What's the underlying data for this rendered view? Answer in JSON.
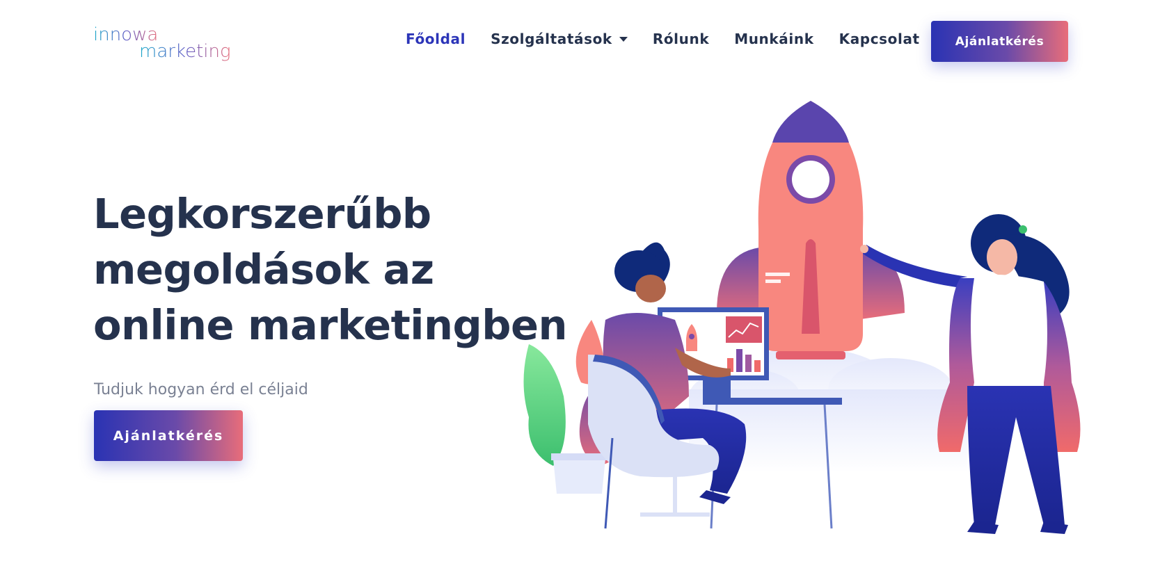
{
  "logo": {
    "line1": "innowa",
    "line2": "marketing"
  },
  "nav": {
    "items": [
      {
        "label": "Főoldal"
      },
      {
        "label": "Szolgáltatások"
      },
      {
        "label": "Rólunk"
      },
      {
        "label": "Munkáink"
      },
      {
        "label": "Kapcsolat"
      }
    ],
    "cta_label": "Ajánlatkérés"
  },
  "hero": {
    "title_lines": [
      "Legkorszerűbb",
      "megoldások az",
      "online marketingben"
    ],
    "subtitle": "Tudjuk hogyan érd el céljaid",
    "cta_label": "Ajánlatkérés"
  },
  "colors": {
    "primary": "#2c35b8",
    "accent": "#e86d7a",
    "text_dark": "#25324d",
    "text_muted": "#7a8193"
  },
  "icons": {
    "dropdown": "chevron-down-icon"
  }
}
